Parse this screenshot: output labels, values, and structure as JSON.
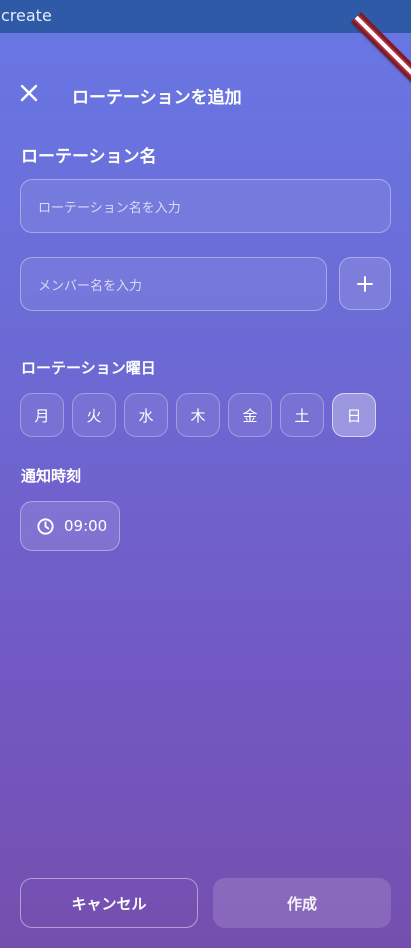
{
  "window": {
    "title": "create"
  },
  "header": {
    "title": "ローテーションを追加"
  },
  "form": {
    "name_label": "ローテーション名",
    "name_placeholder": "ローテーション名を入力",
    "member_placeholder": "メンバー名を入力",
    "days_label": "ローテーション曜日",
    "days": [
      {
        "label": "月",
        "selected": false
      },
      {
        "label": "火",
        "selected": false
      },
      {
        "label": "水",
        "selected": false
      },
      {
        "label": "木",
        "selected": false
      },
      {
        "label": "金",
        "selected": false
      },
      {
        "label": "土",
        "selected": false
      },
      {
        "label": "日",
        "selected": true
      }
    ],
    "time_label": "通知時刻",
    "time_value": "09:00"
  },
  "footer": {
    "cancel_label": "キャンセル",
    "create_label": "作成"
  },
  "icons": {
    "close": "close-icon",
    "add": "plus-icon",
    "clock": "clock-icon"
  },
  "colors": {
    "topbar": "#2f5aa8",
    "gradient_top": "#6877e4",
    "gradient_bottom": "#754fae"
  }
}
